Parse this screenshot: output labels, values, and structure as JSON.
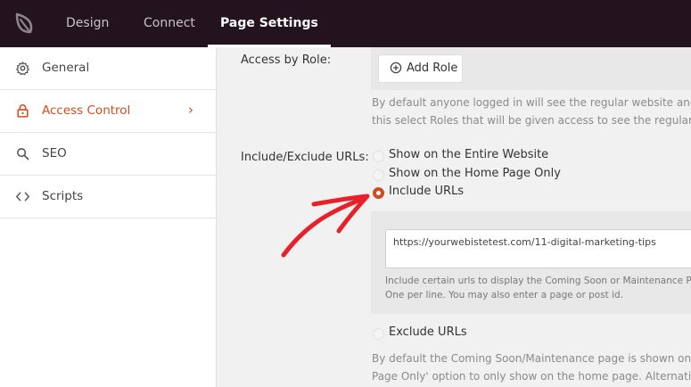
{
  "topbar": {
    "tabs": [
      {
        "label": "Design"
      },
      {
        "label": "Connect"
      },
      {
        "label": "Page Settings"
      }
    ]
  },
  "sidebar": {
    "items": [
      {
        "label": "General",
        "icon": "gear-icon"
      },
      {
        "label": "Access Control",
        "icon": "lock-icon",
        "chevron": "›"
      },
      {
        "label": "SEO",
        "icon": "search-icon"
      },
      {
        "label": "Scripts",
        "icon": "code-icon"
      }
    ]
  },
  "main": {
    "access_by_role": {
      "label": "Access by Role:",
      "button": "Add Role",
      "help_line1": "By default anyone logged in will see the regular website and no",
      "help_line2": "this select Roles that will be given access to see the regular web"
    },
    "include_exclude": {
      "label": "Include/Exclude URLs:",
      "options": [
        {
          "label": "Show on the Entire Website",
          "checked": false
        },
        {
          "label": "Show on the Home Page Only",
          "checked": false
        },
        {
          "label": "Include URLs",
          "checked": true
        },
        {
          "label": "Exclude URLs",
          "checked": false
        }
      ],
      "include_urls_value": "https://yourwebistetest.com/11-digital-marketing-tips",
      "include_help_line1": "Include certain urls to display the Coming Soon or Maintenance Page",
      "include_help_line2": "One per line. You may also enter a page or post id.",
      "exclude_help_line1": "By default the Coming Soon/Maintenance page is shown on ev",
      "exclude_help_line2": "Page Only' option to only show on the home page. Alternativel"
    }
  },
  "colors": {
    "topbar": "#22131f",
    "accent": "#d04c1f",
    "annotation_arrow": "#e8202a"
  }
}
